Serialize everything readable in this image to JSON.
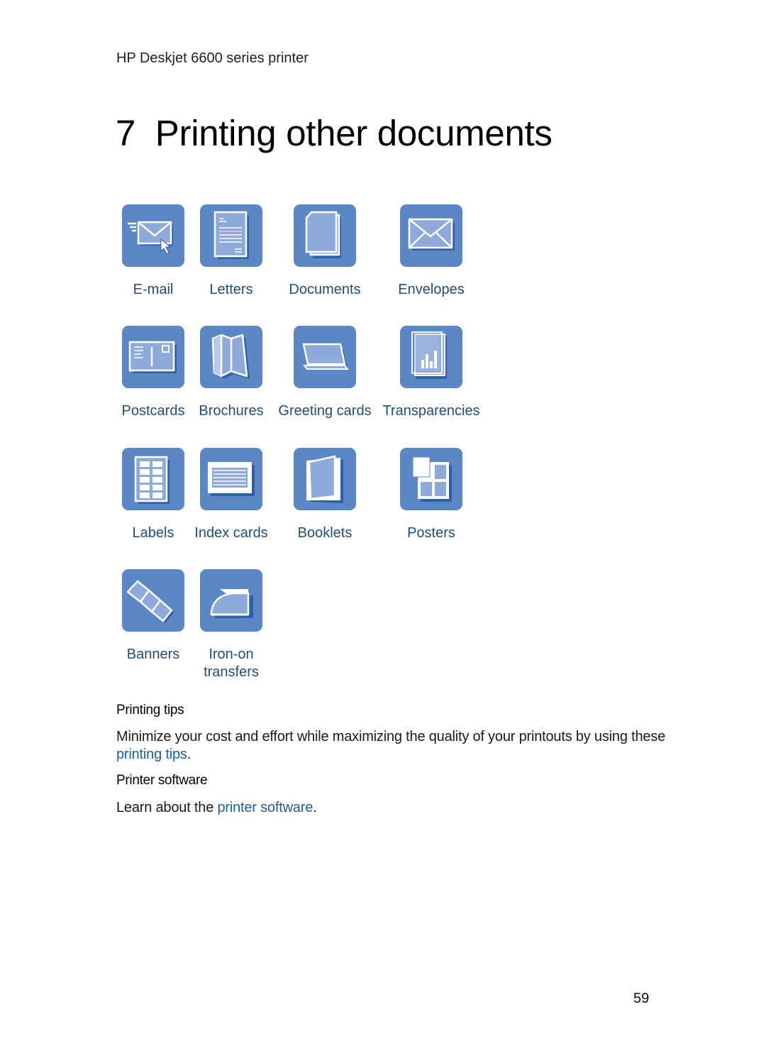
{
  "header": {
    "running_title": "HP Deskjet 6600 series printer"
  },
  "chapter": {
    "title": "7  Printing other documents"
  },
  "colors": {
    "tile_bg": "#5b87c7",
    "tile_inner": "#8ea9db",
    "tile_shadow": "#2f5fa8",
    "link": "#1f4e79"
  },
  "tiles": [
    {
      "label": "E-mail",
      "icon": "email-icon"
    },
    {
      "label": "Letters",
      "icon": "letter-icon"
    },
    {
      "label": "Documents",
      "icon": "documents-icon"
    },
    {
      "label": "Envelopes",
      "icon": "envelope-icon"
    },
    {
      "label": "Postcards",
      "icon": "postcard-icon"
    },
    {
      "label": "Brochures",
      "icon": "brochure-icon"
    },
    {
      "label": "Greeting cards",
      "icon": "greeting-card-icon"
    },
    {
      "label": "Transparencies",
      "icon": "transparency-icon"
    },
    {
      "label": "Labels",
      "icon": "labels-icon"
    },
    {
      "label": "Index cards",
      "icon": "index-card-icon"
    },
    {
      "label": "Booklets",
      "icon": "booklet-icon"
    },
    {
      "label": "Posters",
      "icon": "poster-icon"
    },
    {
      "label": "Banners",
      "icon": "banner-icon"
    },
    {
      "label": "Iron-on transfers",
      "label_line1": "Iron-on",
      "label_line2": "transfers",
      "icon": "iron-icon"
    }
  ],
  "sections": {
    "tips": {
      "heading": "Printing tips",
      "text_before": "Minimize your cost and effort while maximizing the quality of your printouts by using these ",
      "link": "printing tips",
      "text_after": "."
    },
    "software": {
      "heading": "Printer software",
      "text_before": "Learn about the ",
      "link": "printer software",
      "text_after": "."
    }
  },
  "footer": {
    "page_number": "59"
  }
}
